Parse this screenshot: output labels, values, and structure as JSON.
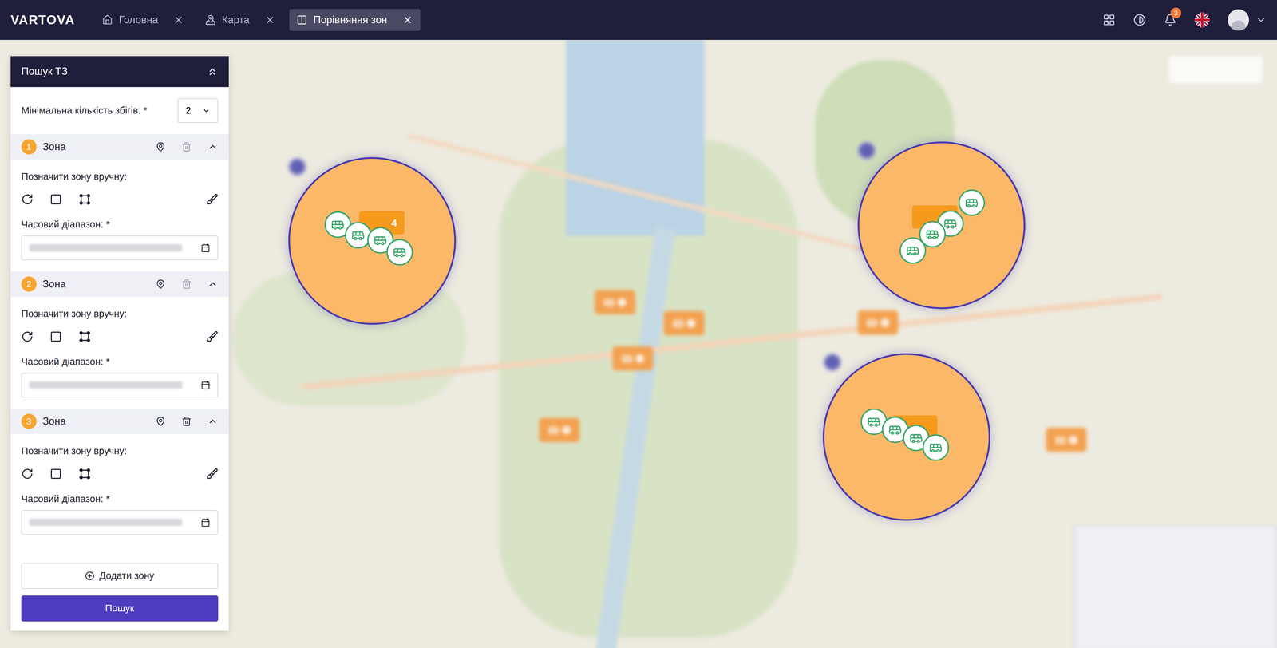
{
  "app": {
    "logo": "VARTOVA"
  },
  "tabs": [
    {
      "label": "Головна",
      "selected": false
    },
    {
      "label": "Карта",
      "selected": false
    },
    {
      "label": "Порівняння зон",
      "selected": true
    }
  ],
  "header": {
    "notifications": "3"
  },
  "panel": {
    "title": "Пошук ТЗ",
    "expanded": true,
    "min_matches": {
      "label": "Мінімальна кількість збігів: *",
      "value": "2"
    },
    "zones": [
      {
        "number": "1",
        "title": "Зона",
        "expanded": true,
        "delete_disabled": true,
        "draw_label": "Позначити зону вручну:",
        "time_label": "Часовий діапазон: *"
      },
      {
        "number": "2",
        "title": "Зона",
        "expanded": true,
        "delete_disabled": true,
        "draw_label": "Позначити зону вручну:",
        "time_label": "Часовий діапазон: *"
      },
      {
        "number": "3",
        "title": "Зона",
        "expanded": true,
        "delete_disabled": false,
        "draw_label": "Позначити зону вручну:",
        "time_label": "Часовий діапазон: *"
      }
    ],
    "add_button": "Додати зону",
    "search_button": "Пошук"
  },
  "map": {
    "zones": [
      {
        "number": "1",
        "vehicles": 4,
        "cluster": "4"
      },
      {
        "number": "2",
        "vehicles": 4,
        "cluster": ""
      },
      {
        "number": "3",
        "vehicles": 4,
        "cluster": ""
      }
    ],
    "group_markers": 6,
    "points": 3
  }
}
